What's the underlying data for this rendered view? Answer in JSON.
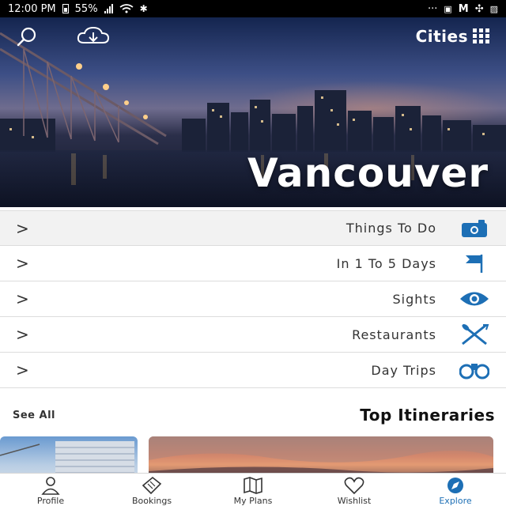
{
  "status_bar": {
    "time": "12:00 PM",
    "battery": "55%",
    "dots": "···"
  },
  "header": {
    "logo_text": "Cities",
    "city": "Vancouver"
  },
  "menu": {
    "items": [
      {
        "label": "Things To Do",
        "icon": "camera-icon"
      },
      {
        "label": "In 1 To 5 Days",
        "icon": "flag-icon"
      },
      {
        "label": "Sights",
        "icon": "eye-icon"
      },
      {
        "label": "Restaurants",
        "icon": "utensils-icon"
      },
      {
        "label": "Day Trips",
        "icon": "binoculars-icon"
      }
    ],
    "chevron": ">"
  },
  "itineraries": {
    "title": "Top Itineraries",
    "see_all": "See All"
  },
  "tabs": [
    {
      "label": "Explore",
      "icon": "compass-icon",
      "active": true
    },
    {
      "label": "Wishlist",
      "icon": "heart-icon",
      "active": false
    },
    {
      "label": "My Plans",
      "icon": "map-icon",
      "active": false
    },
    {
      "label": "Bookings",
      "icon": "ticket-icon",
      "active": false
    },
    {
      "label": "Profile",
      "icon": "user-icon",
      "active": false
    }
  ],
  "colors": {
    "accent": "#1d6fb5",
    "status_bar": "#000000"
  }
}
